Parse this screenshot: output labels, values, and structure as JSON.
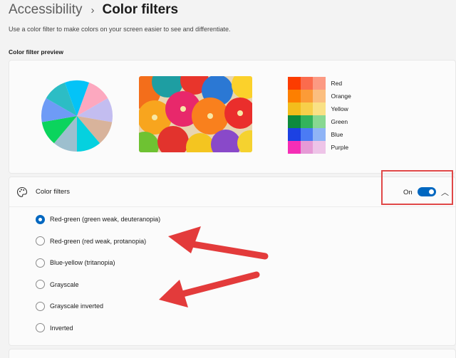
{
  "breadcrumb": {
    "parent": "Accessibility",
    "separator": "›",
    "current": "Color filters"
  },
  "description": "Use a color filter to make colors on your screen easier to see and differentiate.",
  "preview": {
    "label": "Color filter preview",
    "pie_colors": [
      "#04c3f7",
      "#fca8bf",
      "#c3bdf0",
      "#d8b39b",
      "#05d1df",
      "#9dbfce",
      "#0bd45d",
      "#6e9bf6",
      "#2cbdc5"
    ],
    "swatches": [
      {
        "label": "Red",
        "colors": [
          "#fc3c00",
          "#fb6b4d",
          "#fc9a83"
        ]
      },
      {
        "label": "Orange",
        "colors": [
          "#fd7f00",
          "#fc9b37",
          "#fbbe7f"
        ]
      },
      {
        "label": "Yellow",
        "colors": [
          "#f3bd1c",
          "#f7cf4a",
          "#f9e185"
        ]
      },
      {
        "label": "Green",
        "colors": [
          "#0d8a3c",
          "#33b35c",
          "#88d892"
        ]
      },
      {
        "label": "Blue",
        "colors": [
          "#1c41e3",
          "#4b7bf4",
          "#8fb4f6"
        ]
      },
      {
        "label": "Purple",
        "colors": [
          "#f52eb6",
          "#e69ad6",
          "#eec4e8"
        ]
      }
    ]
  },
  "filters": {
    "title": "Color filters",
    "toggle_state": "On",
    "toggle_on": true,
    "options": [
      {
        "label": "Red-green (green weak, deuteranopia)",
        "selected": true
      },
      {
        "label": "Red-green (red weak, protanopia)",
        "selected": false
      },
      {
        "label": "Blue-yellow (tritanopia)",
        "selected": false
      },
      {
        "label": "Grayscale",
        "selected": false
      },
      {
        "label": "Grayscale inverted",
        "selected": false
      },
      {
        "label": "Inverted",
        "selected": false
      }
    ]
  },
  "icons": {
    "palette": "palette-icon",
    "chevron": "chevron-up-icon",
    "separator": "chevron-right-icon"
  },
  "accent_color": "#0067c0",
  "annotation_color": "#e04848"
}
